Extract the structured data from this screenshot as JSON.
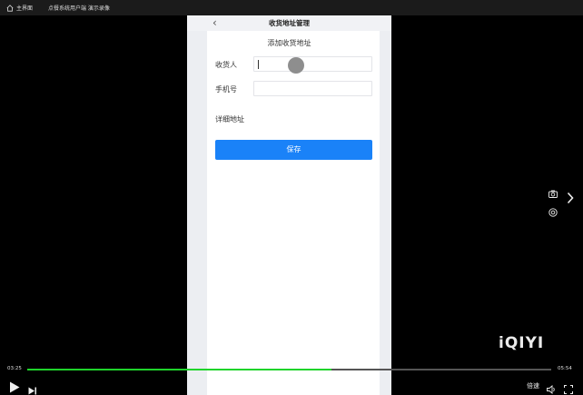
{
  "topbar": {
    "home_label": "主界面",
    "video_title": "点餐系统用户端 演示录像"
  },
  "phone": {
    "nav_title": "收货地址管理",
    "section_title": "添加收货地址",
    "fields": [
      {
        "label": "收货人",
        "value": ""
      },
      {
        "label": "手机号",
        "value": ""
      },
      {
        "label": "详细地址",
        "value": ""
      }
    ],
    "save_label": "保存"
  },
  "player": {
    "current_time": "03:25",
    "total_time": "05:54",
    "progress": 0.58,
    "speed_label": "倍速",
    "watermark": "iQIYI",
    "accent": "#1fd42b"
  },
  "colors": {
    "save_button": "#1a82f8"
  }
}
